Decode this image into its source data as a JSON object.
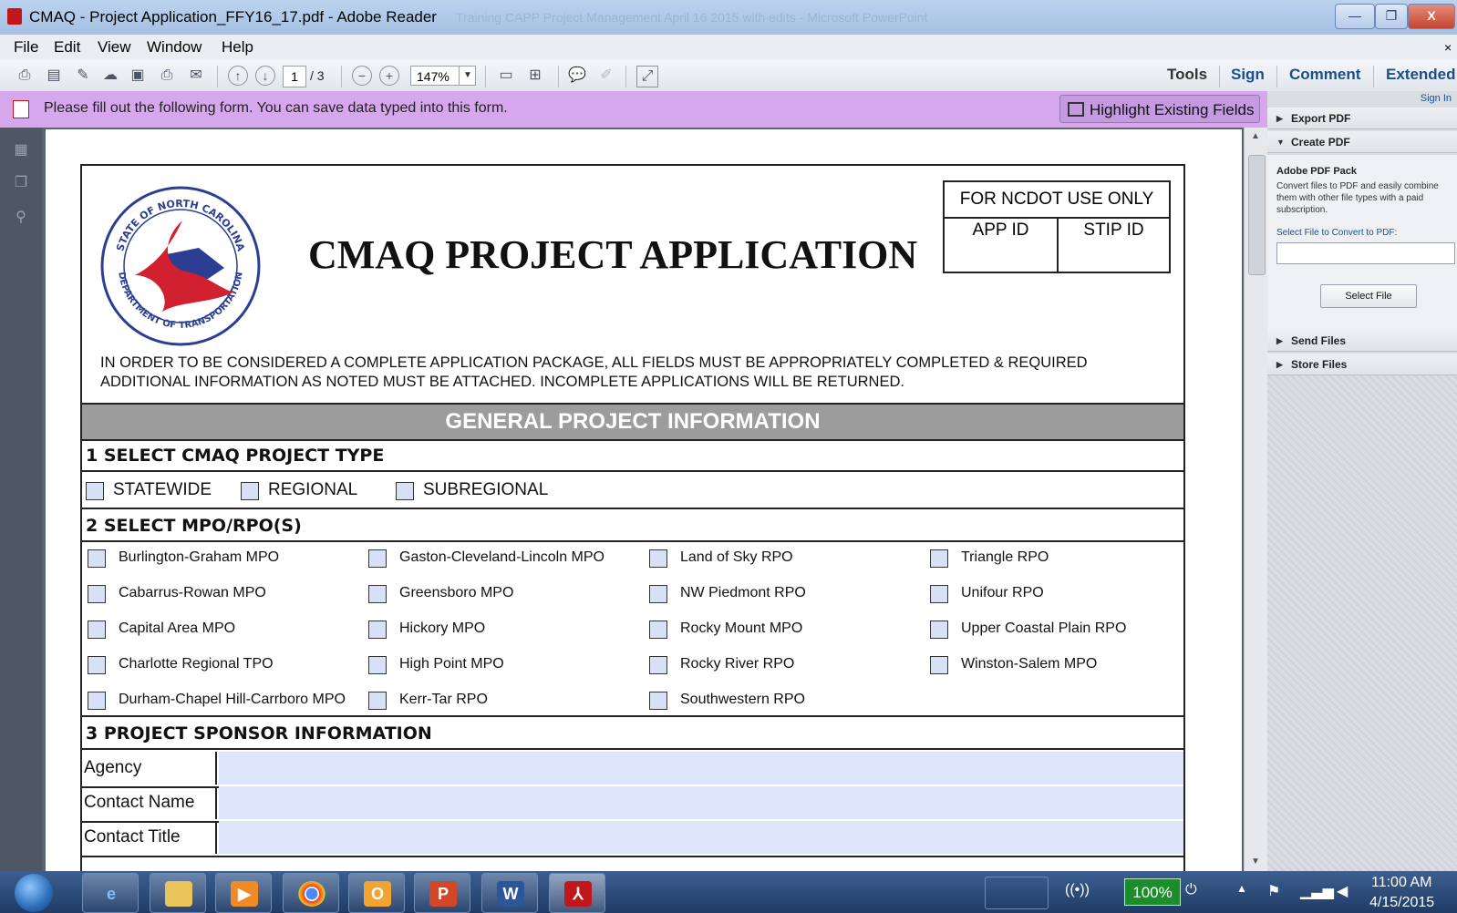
{
  "window": {
    "title": "CMAQ - Project Application_FFY16_17.pdf - Adobe Reader",
    "background_title": "Training CAPP Project Management April 16 2015 with edits - Microsoft PowerPoint",
    "controls": {
      "minimize": "—",
      "maximize": "❐",
      "close": "X"
    }
  },
  "menu": {
    "items": [
      "File",
      "Edit",
      "View",
      "Window",
      "Help"
    ],
    "close_doc": "×"
  },
  "toolbar": {
    "page_current": "1",
    "page_total": "/ 3",
    "zoom": "147%",
    "links": {
      "tools": "Tools",
      "sign": "Sign",
      "comment": "Comment",
      "extended": "Extended"
    }
  },
  "notice": {
    "message": "Please fill out the following form. You can save data typed into this form.",
    "highlight_button": "Highlight Existing Fields"
  },
  "right_panel": {
    "sign_in": "Sign In",
    "export_pdf": "Export PDF",
    "create_pdf": "Create PDF",
    "pack_title": "Adobe PDF Pack",
    "pack_desc": "Convert files to PDF and easily combine them with other file types with a paid subscription.",
    "select_link": "Select File to Convert to PDF:",
    "select_button": "Select File",
    "send_files": "Send Files",
    "store_files": "Store Files"
  },
  "form": {
    "logo_text_top": "STATE OF NORTH CAROLINA",
    "logo_text_bottom": "DEPARTMENT OF TRANSPORTATION",
    "title": "CMAQ PROJECT APPLICATION",
    "ncdot_box": {
      "header": "FOR NCDOT USE ONLY",
      "col1": "APP ID",
      "col2": "STIP ID"
    },
    "instructions": "IN ORDER TO BE CONSIDERED A COMPLETE APPLICATION PACKAGE, ALL FIELDS MUST BE APPROPRIATELY COMPLETED & REQUIRED ADDITIONAL INFORMATION AS NOTED MUST BE ATTACHED. INCOMPLETE APPLICATIONS WILL BE RETURNED.",
    "general_header": "GENERAL PROJECT INFORMATION",
    "section1": "1 SELECT CMAQ PROJECT TYPE",
    "project_types": [
      "STATEWIDE",
      "REGIONAL",
      "SUBREGIONAL"
    ],
    "section2": "2 SELECT MPO/RPO(S)",
    "mpo_columns": [
      [
        "Burlington-Graham MPO",
        "Cabarrus-Rowan MPO",
        "Capital Area MPO",
        "Charlotte Regional TPO",
        "Durham-Chapel Hill-Carrboro MPO"
      ],
      [
        "Gaston-Cleveland-Lincoln MPO",
        "Greensboro MPO",
        "Hickory MPO",
        "High Point MPO",
        "Kerr-Tar RPO"
      ],
      [
        "Land of Sky RPO",
        "NW Piedmont RPO",
        "Rocky Mount MPO",
        "Rocky River RPO",
        "Southwestern RPO"
      ],
      [
        "Triangle RPO",
        "Unifour RPO",
        "Upper Coastal Plain RPO",
        "Winston-Salem MPO"
      ]
    ],
    "section3": "3 PROJECT SPONSOR INFORMATION",
    "sponsor_fields": [
      "Agency",
      "Contact Name",
      "Contact Title"
    ]
  },
  "taskbar": {
    "battery": "100%",
    "time": "11:00 AM",
    "date": "4/15/2015"
  }
}
